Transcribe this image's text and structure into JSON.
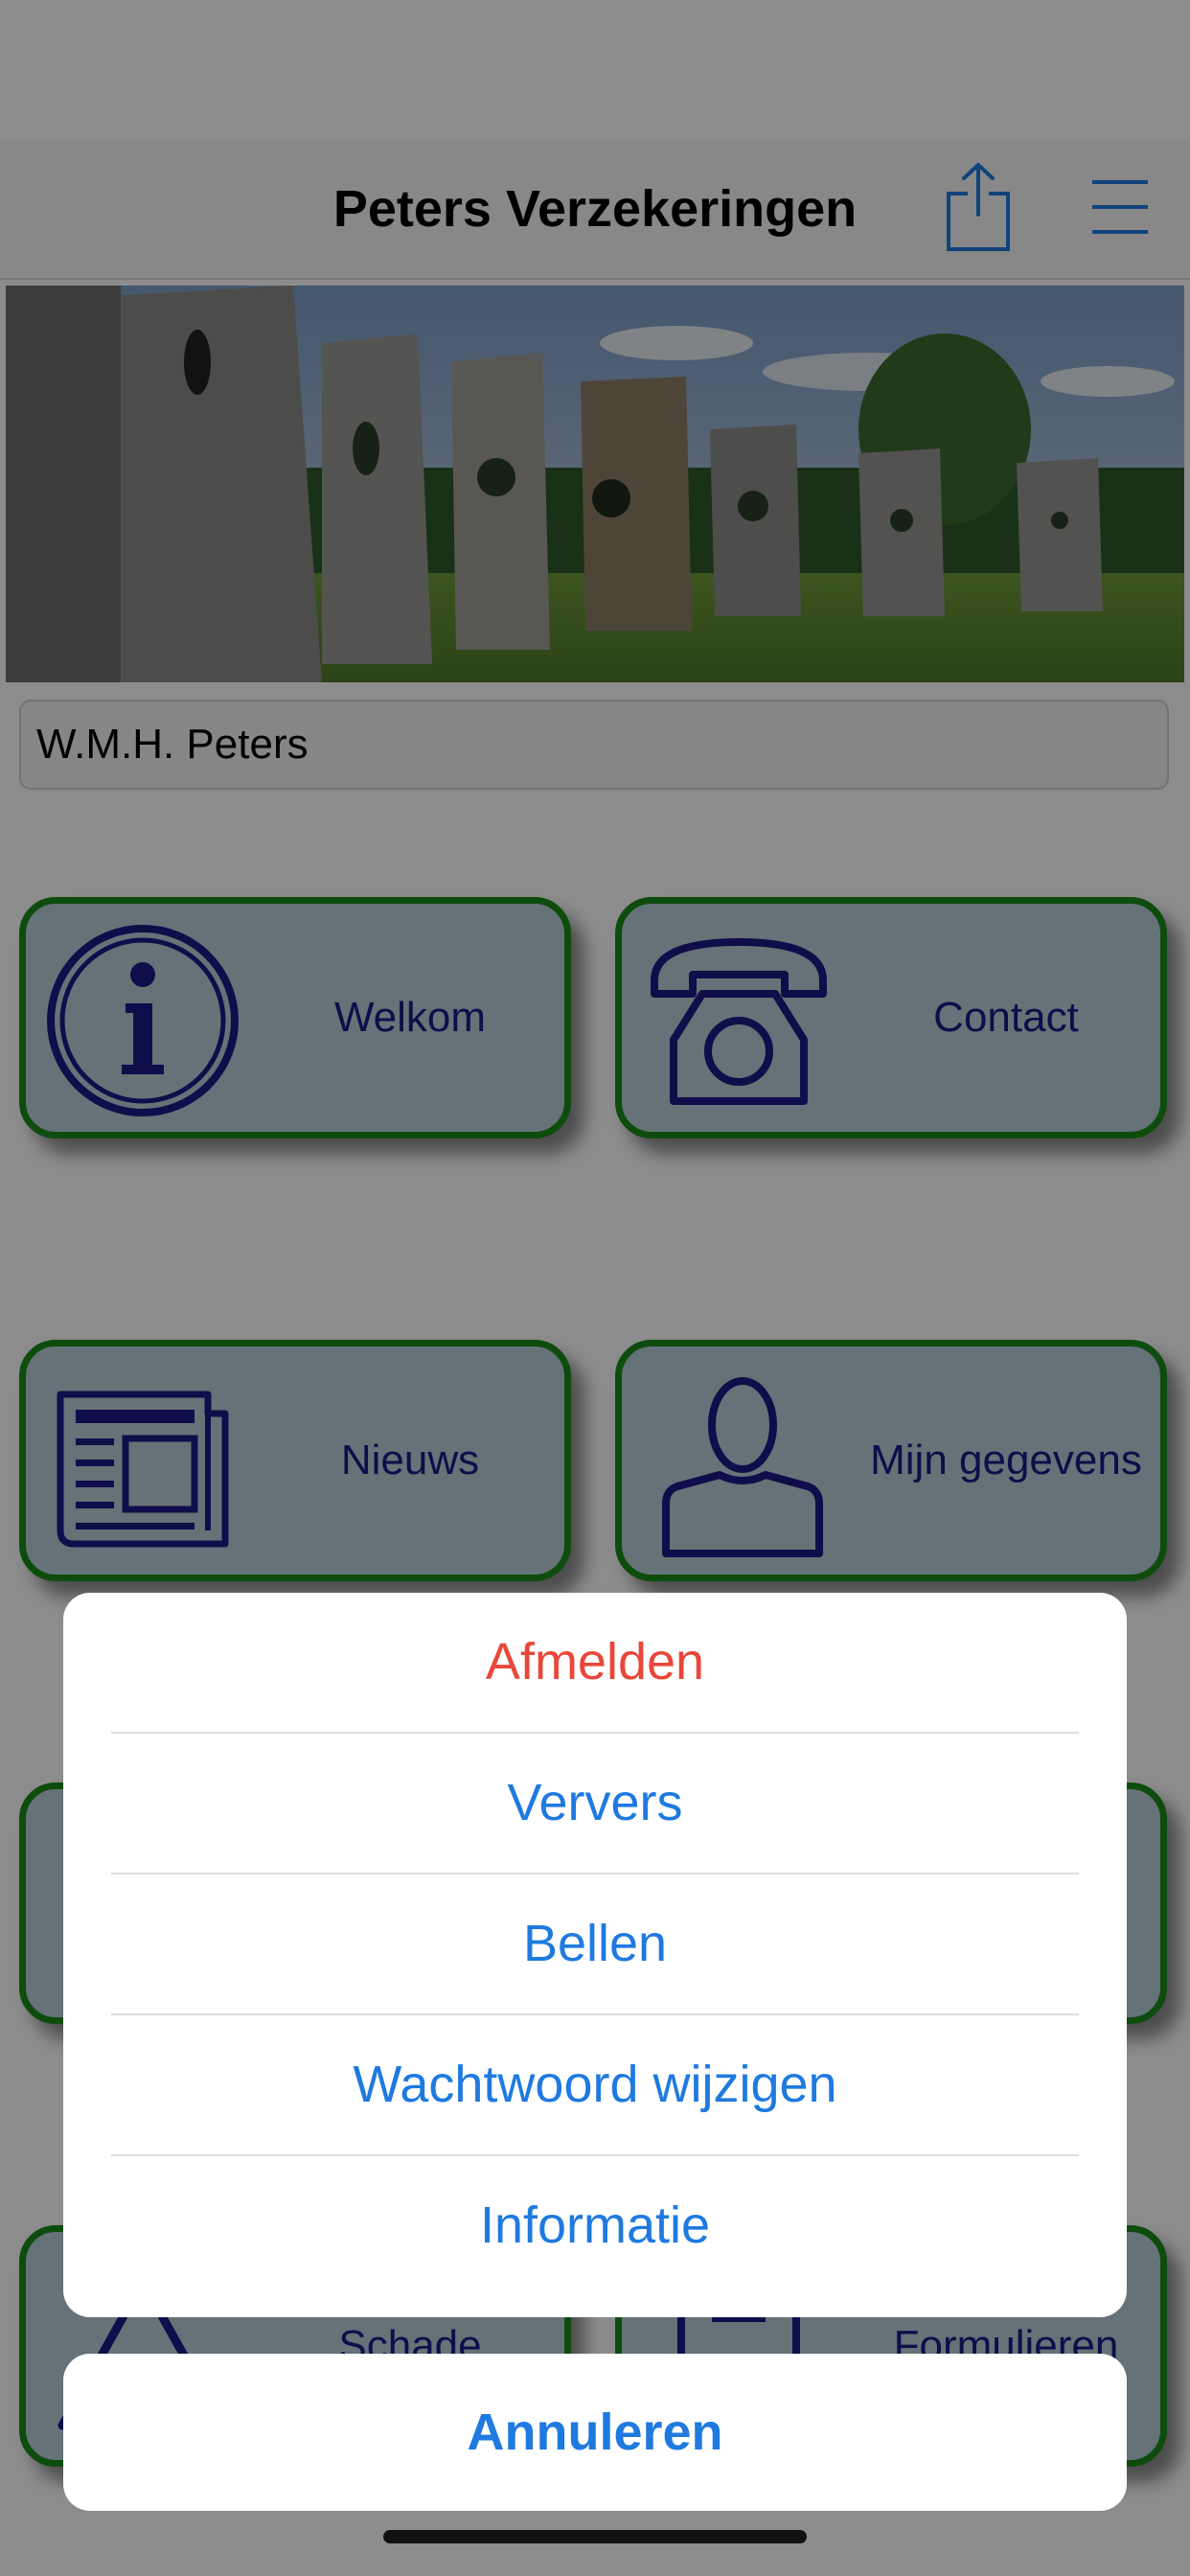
{
  "header": {
    "title": "Peters Verzekeringen",
    "share_icon": "share-icon",
    "menu_icon": "hamburger-menu-icon"
  },
  "user": {
    "name": "W.M.H. Peters"
  },
  "tiles": [
    {
      "label": "Welkom",
      "icon": "info-icon"
    },
    {
      "label": "Contact",
      "icon": "telephone-icon"
    },
    {
      "label": "Nieuws",
      "icon": "newspaper-icon"
    },
    {
      "label": "Mijn gegevens",
      "icon": "person-icon"
    },
    {
      "label": "Schade",
      "icon": "warning-icon"
    },
    {
      "label": "Formulieren",
      "icon": "form-icon"
    }
  ],
  "action_sheet": {
    "items": [
      {
        "label": "Afmelden",
        "style": "destructive"
      },
      {
        "label": "Ververs",
        "style": "default"
      },
      {
        "label": "Bellen",
        "style": "default"
      },
      {
        "label": "Wachtwoord wijzigen",
        "style": "default"
      },
      {
        "label": "Informatie",
        "style": "default"
      }
    ],
    "cancel_label": "Annuleren"
  },
  "colors": {
    "accent_blue": "#1f7ae0",
    "destructive_red": "#e8473a",
    "tile_border_green": "#1b8a1b",
    "tile_fill": "#b8cfd9",
    "icon_navy": "#1a1a88"
  }
}
